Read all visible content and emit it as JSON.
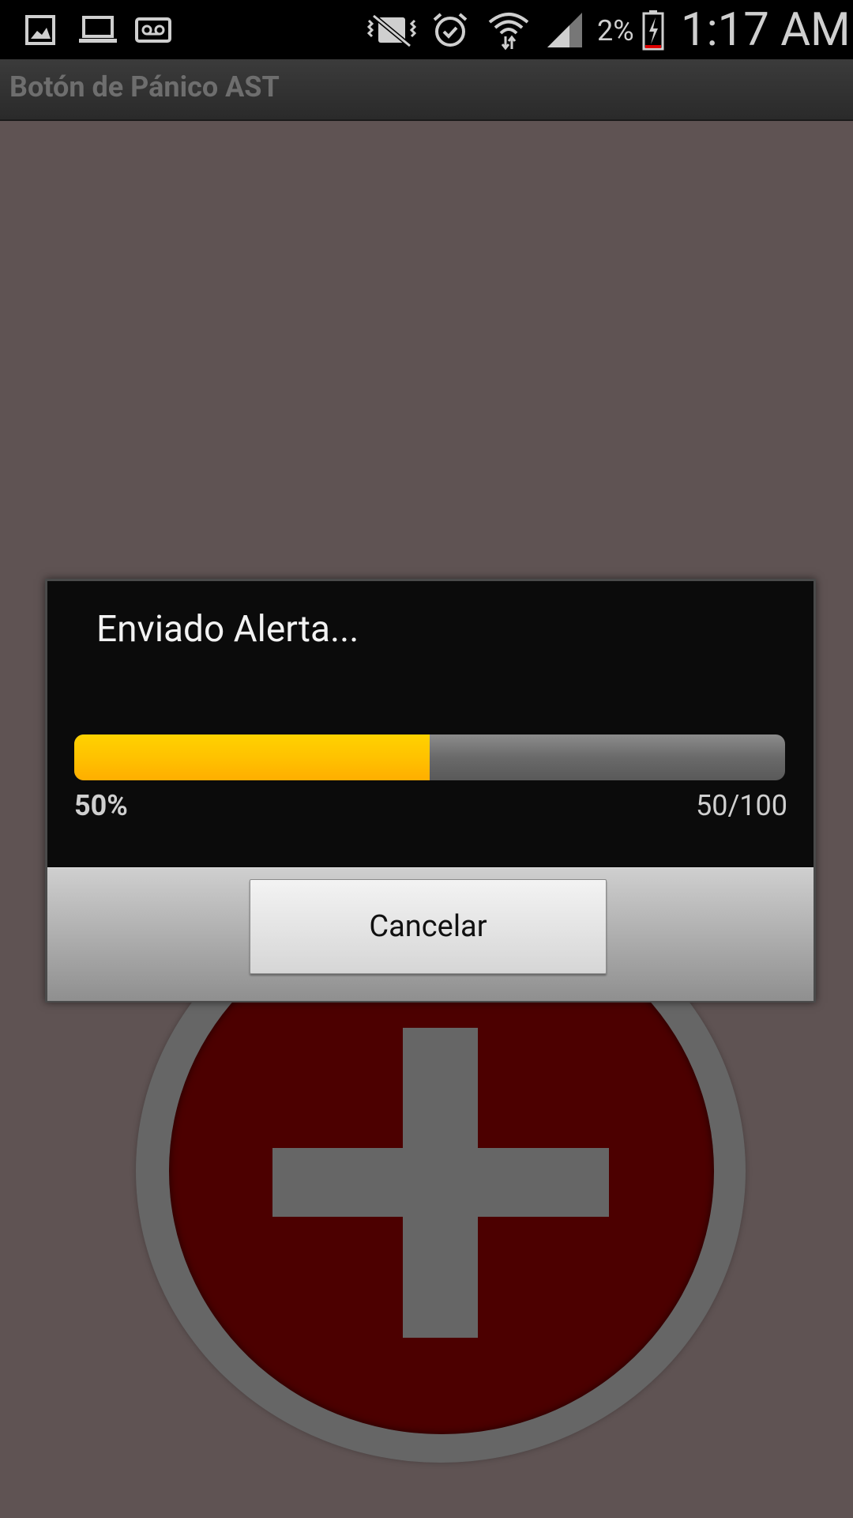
{
  "status_bar": {
    "icons": [
      "gallery-icon",
      "laptop-icon",
      "voicemail-icon",
      "vibrate-icon",
      "alarm-icon",
      "wifi-icon",
      "signal-icon",
      "battery-charging-icon"
    ],
    "battery_percent": "2%",
    "time": "1:17 AM"
  },
  "action_bar": {
    "title": "Botón de Pánico AST"
  },
  "dialog": {
    "title": "Enviado Alerta...",
    "progress": {
      "fraction": 0.5,
      "percent_label": "50%",
      "count_label": "50/100"
    },
    "cancel_label": "Cancelar"
  },
  "colors": {
    "background": "#5f5353",
    "dialog": "#0b0b0b",
    "progress_fill": "#ffc200",
    "panic_red": "#4c0000",
    "panic_ring": "#666666"
  }
}
